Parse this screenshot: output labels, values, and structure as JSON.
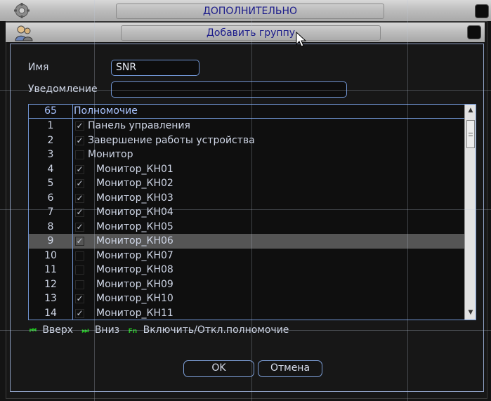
{
  "window": {
    "title": "ДОПОЛНИТЕЛЬНО",
    "icon": "settings-icon"
  },
  "dialog": {
    "title": "Добавить группу",
    "icon": "users-icon"
  },
  "form": {
    "name_label": "Имя",
    "name_value": "SNR",
    "note_label": "Уведомление",
    "note_value": ""
  },
  "table": {
    "header_count": "65",
    "header_perm": "Полномочие",
    "rows": [
      {
        "num": "1",
        "checked": true,
        "label": "Панель управления",
        "indent": false,
        "selected": false
      },
      {
        "num": "2",
        "checked": true,
        "label": "Завершение работы устройства",
        "indent": false,
        "selected": false
      },
      {
        "num": "3",
        "checked": false,
        "label": "Монитор",
        "indent": false,
        "selected": false
      },
      {
        "num": "4",
        "checked": true,
        "label": "Монитор_КН01",
        "indent": true,
        "selected": false
      },
      {
        "num": "5",
        "checked": true,
        "label": "Монитор_КН02",
        "indent": true,
        "selected": false
      },
      {
        "num": "6",
        "checked": true,
        "label": "Монитор_КН03",
        "indent": true,
        "selected": false
      },
      {
        "num": "7",
        "checked": true,
        "label": "Монитор_КН04",
        "indent": true,
        "selected": false
      },
      {
        "num": "8",
        "checked": true,
        "label": "Монитор_КН05",
        "indent": true,
        "selected": false
      },
      {
        "num": "9",
        "checked": true,
        "label": "Монитор_КН06",
        "indent": true,
        "selected": true
      },
      {
        "num": "10",
        "checked": false,
        "label": "Монитор_КН07",
        "indent": true,
        "selected": false
      },
      {
        "num": "11",
        "checked": false,
        "label": "Монитор_КН08",
        "indent": true,
        "selected": false
      },
      {
        "num": "12",
        "checked": false,
        "label": "Монитор_КН09",
        "indent": true,
        "selected": false
      },
      {
        "num": "13",
        "checked": true,
        "label": "Монитор_КН10",
        "indent": true,
        "selected": false
      },
      {
        "num": "14",
        "checked": true,
        "label": "Монитор_КН11",
        "indent": true,
        "selected": false
      }
    ]
  },
  "hints": {
    "up_key": "⏮",
    "up_label": "Вверх",
    "down_key": "⏭",
    "down_label": "Вниз",
    "fn_key": "Fn",
    "fn_label": "Включить/Откл.полномочие"
  },
  "buttons": {
    "ok": "OK",
    "cancel": "Отмена"
  },
  "colors": {
    "accent_border": "#6f93d0",
    "hint_green": "#22c022",
    "title_text": "#1b1b8a"
  }
}
